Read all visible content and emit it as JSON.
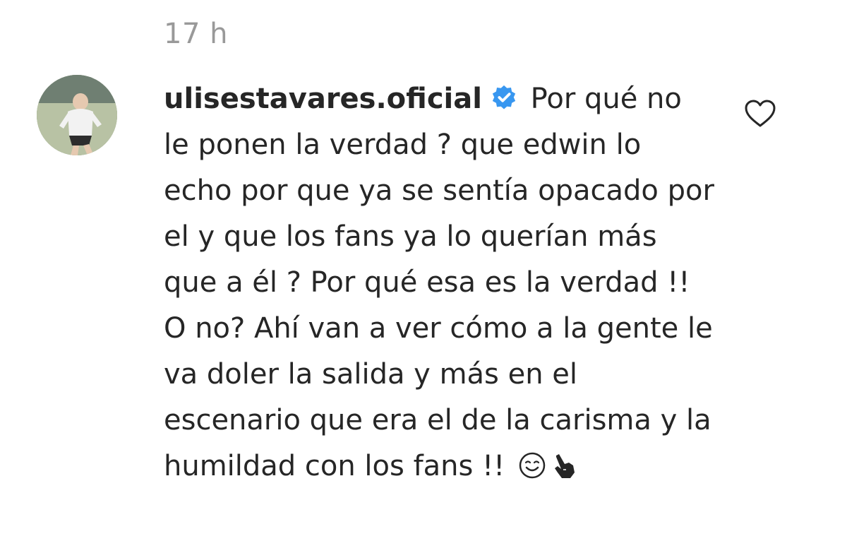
{
  "comment": {
    "timestamp": "17 h",
    "username": "ulisestavares.oficial",
    "verified": true,
    "text": "Por qué no le ponen la verdad ? que edwin lo echo por que ya se sentía opacado por el y que los fans ya lo querían más que a él ? Por qué esa es la verdad !! O no? Ahí van a ver cómo a la gente le va doler la salida y más en el escenario que era el de la carisma y la humildad con los fans !!",
    "emojis": [
      "smiling-face-icon",
      "pointing-hand-icon"
    ]
  },
  "colors": {
    "verified_badge": "#3897f0",
    "timestamp": "#999999",
    "text": "#262626"
  },
  "icons": {
    "like": "heart-outline-icon",
    "verified": "verified-badge-icon"
  }
}
